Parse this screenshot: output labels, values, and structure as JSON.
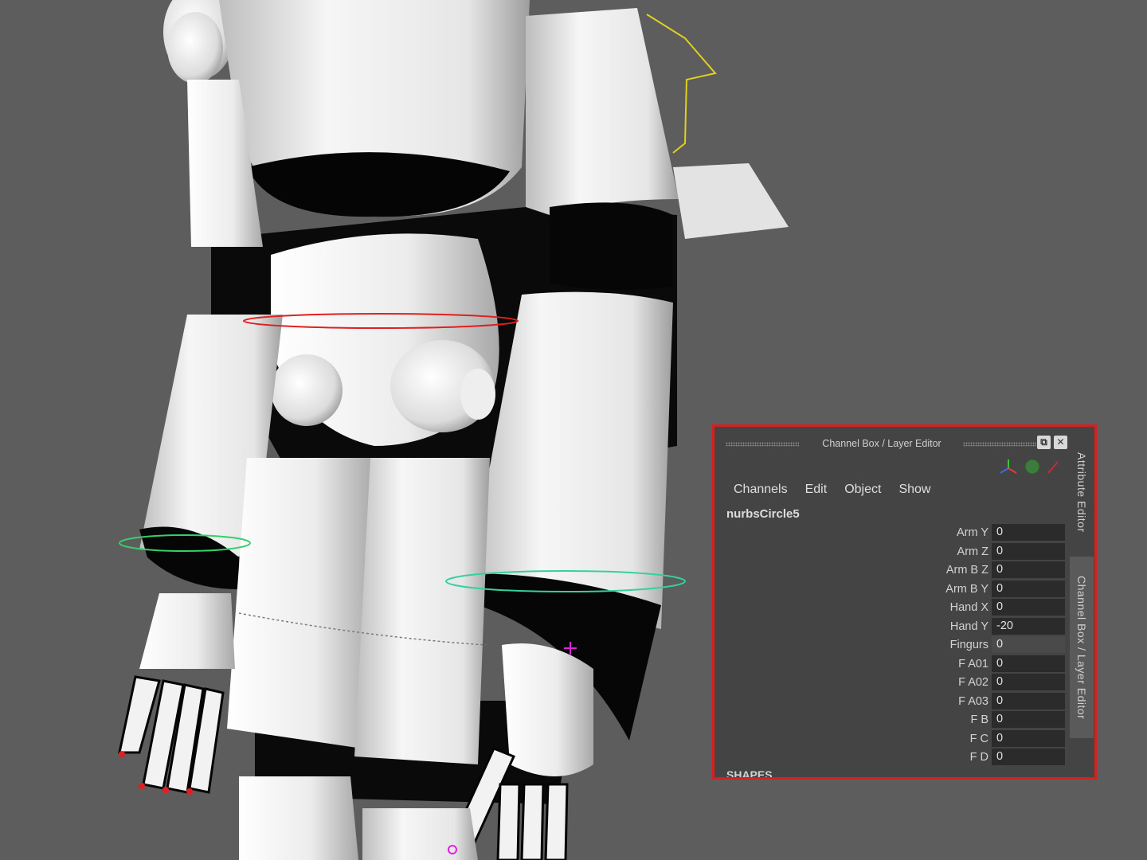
{
  "viewport": {
    "background_color": "#5d5d5d"
  },
  "channel_box": {
    "title": "Channel Box / Layer Editor",
    "border_color": "#d81e1e",
    "menu": [
      "Channels",
      "Edit",
      "Object",
      "Show"
    ],
    "object_name": "nurbsCircle5",
    "channels": [
      {
        "label": "Arm Y",
        "value": "0"
      },
      {
        "label": "Arm Z",
        "value": "0"
      },
      {
        "label": "Arm B Z",
        "value": "0"
      },
      {
        "label": "Arm B Y",
        "value": "0"
      },
      {
        "label": "Hand X",
        "value": "0"
      },
      {
        "label": "Hand Y",
        "value": "-20"
      },
      {
        "label": "Fingurs",
        "value": "0"
      },
      {
        "label": "F A01",
        "value": "0"
      },
      {
        "label": "F A02",
        "value": "0"
      },
      {
        "label": "F A03",
        "value": "0"
      },
      {
        "label": "F B",
        "value": "0"
      },
      {
        "label": "F C",
        "value": "0"
      },
      {
        "label": "F D",
        "value": "0"
      }
    ],
    "shapes_label": "SHAPES",
    "side_tabs": {
      "attribute_editor": "Attribute Editor",
      "channel_box": "Channel Box / Layer Editor"
    },
    "icons": [
      "float-icon",
      "close-icon",
      "axis-icon",
      "sphere-icon",
      "brush-icon"
    ]
  }
}
